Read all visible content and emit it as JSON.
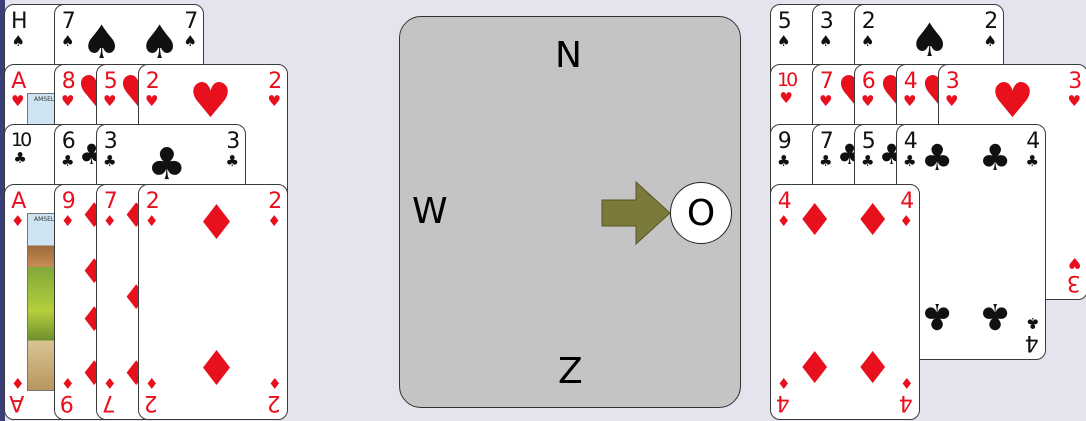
{
  "colors": {
    "red_suit": "#e8101c",
    "black_suit": "#111111",
    "board": "#c4c4c4",
    "arrow": "#7b7a3a"
  },
  "table": {
    "north": "N",
    "west": "W",
    "south": "Z",
    "east": "O",
    "turn_indicator": "arrow-right-icon",
    "active_seat": "O"
  },
  "west_hand": {
    "spades": [
      {
        "rank": "H",
        "suit": "♠"
      },
      {
        "rank": "7",
        "suit": "♠"
      }
    ],
    "hearts": [
      {
        "rank": "A",
        "suit": "♥"
      },
      {
        "rank": "8",
        "suit": "♥"
      },
      {
        "rank": "5",
        "suit": "♥"
      },
      {
        "rank": "2",
        "suit": "♥"
      }
    ],
    "clubs": [
      {
        "rank": "10",
        "suit": "♣"
      },
      {
        "rank": "6",
        "suit": "♣"
      },
      {
        "rank": "3",
        "suit": "♣"
      }
    ],
    "diamonds": [
      {
        "rank": "A",
        "suit": "♦"
      },
      {
        "rank": "9",
        "suit": "♦"
      },
      {
        "rank": "7",
        "suit": "♦"
      },
      {
        "rank": "2",
        "suit": "♦"
      }
    ]
  },
  "east_hand": {
    "spades": [
      {
        "rank": "5",
        "suit": "♠"
      },
      {
        "rank": "3",
        "suit": "♠"
      },
      {
        "rank": "2",
        "suit": "♠"
      }
    ],
    "hearts": [
      {
        "rank": "10",
        "suit": "♥"
      },
      {
        "rank": "7",
        "suit": "♥"
      },
      {
        "rank": "6",
        "suit": "♥"
      },
      {
        "rank": "4",
        "suit": "♥"
      },
      {
        "rank": "3",
        "suit": "♥"
      }
    ],
    "clubs": [
      {
        "rank": "9",
        "suit": "♣"
      },
      {
        "rank": "7",
        "suit": "♣"
      },
      {
        "rank": "5",
        "suit": "♣"
      },
      {
        "rank": "4",
        "suit": "♣"
      }
    ],
    "diamonds": [
      {
        "rank": "4",
        "suit": "♦"
      }
    ]
  },
  "ace_card_text": "AMSEL"
}
